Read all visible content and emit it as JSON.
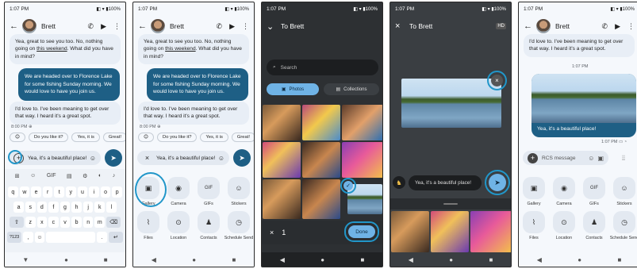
{
  "status": {
    "time": "1:07 PM",
    "battery": "100%"
  },
  "contact": {
    "name": "Brett",
    "to_label": "To Brett"
  },
  "messages": {
    "incoming1": "Yea, great to see you too. No, nothing going on this weekend. What did you have in mind?",
    "incoming1_link": "this weekend",
    "outgoing1": "We are headed over to Florence Lake for some fishing Sunday morning. We would love to have you join us.",
    "incoming2": "I'd love to. I've been meaning to get over that way. I heard it's a great spot.",
    "incoming2_time": "8:00 PM",
    "sent_time": "1:07 PM",
    "sent_photo_caption": "Yea, it's a beautiful place!",
    "sent_photo_time": "1:07 PM"
  },
  "smart_replies": [
    "😊",
    "Do you like it?",
    "Yes, it is",
    "Great!"
  ],
  "compose": {
    "draft": "Yea, it's a beautiful place!",
    "placeholder": "RCS message"
  },
  "keyboard": {
    "row1": [
      "q",
      "w",
      "e",
      "r",
      "t",
      "y",
      "u",
      "i",
      "o",
      "p"
    ],
    "row2": [
      "a",
      "s",
      "d",
      "f",
      "g",
      "h",
      "j",
      "k",
      "l"
    ],
    "row3": [
      "z",
      "x",
      "c",
      "v",
      "b",
      "n",
      "m"
    ],
    "bottom_left": "?123",
    "comma": ",",
    "period": "."
  },
  "attachments": {
    "row1": [
      "Gallery",
      "Camera",
      "GIFs",
      "Stickers"
    ],
    "row2": [
      "Files",
      "Location",
      "Contacts",
      "Schedule Send"
    ]
  },
  "picker": {
    "search_placeholder": "Search",
    "tab_photos": "Photos",
    "tab_collections": "Collections",
    "selected_count": "1",
    "done_label": "Done"
  },
  "colors": {
    "accent": "#1e5f85",
    "highlight": "#2196c9"
  }
}
